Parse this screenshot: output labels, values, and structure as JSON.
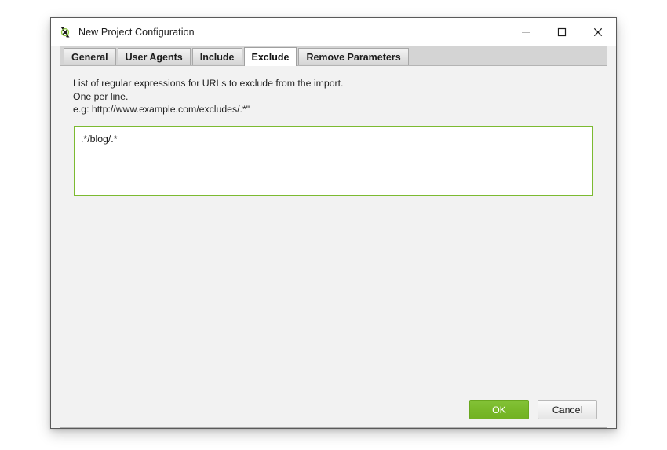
{
  "window": {
    "title": "New Project Configuration",
    "icon": "spider-app-icon",
    "controls": {
      "minimize": "minimize-icon",
      "maximize": "maximize-icon",
      "close": "close-icon"
    }
  },
  "tabs": [
    {
      "label": "General",
      "selected": false
    },
    {
      "label": "User Agents",
      "selected": false
    },
    {
      "label": "Include",
      "selected": false
    },
    {
      "label": "Exclude",
      "selected": true
    },
    {
      "label": "Remove Parameters",
      "selected": false
    }
  ],
  "content": {
    "description_lines": [
      "List of regular expressions for URLs to exclude from the import.",
      "One per line.",
      "e.g: http://www.example.com/excludes/.*\""
    ],
    "exclude_textarea": {
      "value": ".*/blog/.*",
      "placeholder": ""
    }
  },
  "footer": {
    "ok_label": "OK",
    "cancel_label": "Cancel"
  },
  "colors": {
    "accent_green": "#79b92a",
    "field_border_green": "#7cba31",
    "tabstrip_bg": "#d4d4d4",
    "panel_bg": "#f2f2f2",
    "titlebar_bg": "#ffffff",
    "dialog_border": "#5a5a5a"
  }
}
